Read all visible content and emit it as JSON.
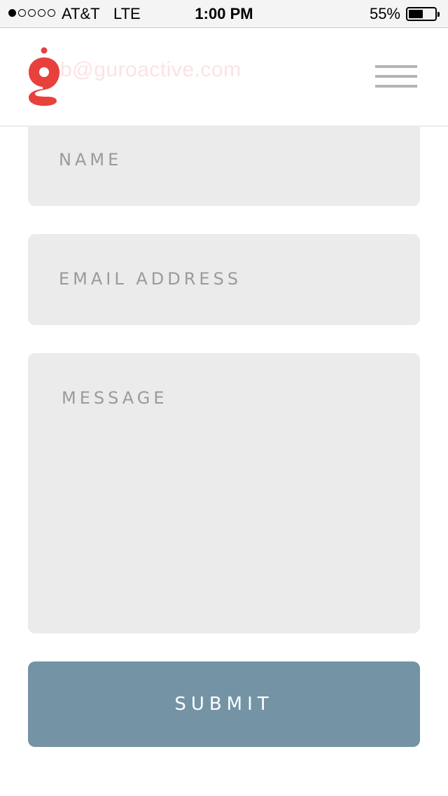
{
  "status_bar": {
    "carrier": "AT&T",
    "network": "LTE",
    "time": "1:00 PM",
    "battery_percent_text": "55%",
    "battery_level": 0.55,
    "signal_bars_filled": 1,
    "signal_bars_total": 5
  },
  "header": {
    "logo_color": "#e8413c",
    "email_text": "b@guroactive.com",
    "menu_icon": "hamburger-menu-icon"
  },
  "form": {
    "name_placeholder": "NAME",
    "email_placeholder": "EMAIL ADDRESS",
    "message_placeholder": "MESSAGE",
    "submit_label": "SUBMIT"
  },
  "colors": {
    "accent": "#7494a6",
    "field_background": "#ebebeb",
    "brand": "#e8413c"
  }
}
